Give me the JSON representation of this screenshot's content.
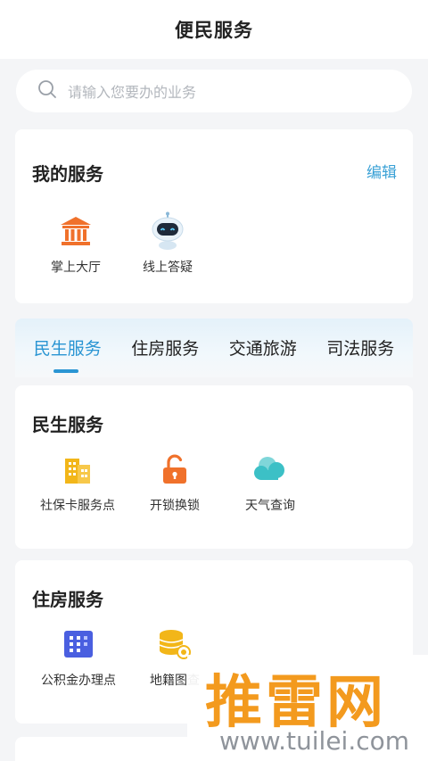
{
  "header": {
    "title": "便民服务"
  },
  "search": {
    "placeholder": "请输入您要办的业务"
  },
  "my_services": {
    "title": "我的服务",
    "edit_label": "编辑",
    "items": [
      {
        "label": "掌上大厅",
        "icon": "government-building-icon"
      },
      {
        "label": "线上答疑",
        "icon": "robot-assistant-icon"
      }
    ]
  },
  "tabs": {
    "active": "民生服务",
    "items": [
      {
        "label": "民生服务"
      },
      {
        "label": "住房服务"
      },
      {
        "label": "交通旅游"
      },
      {
        "label": "司法服务"
      }
    ]
  },
  "livelihood": {
    "title": "民生服务",
    "items": [
      {
        "label": "社保卡服务点",
        "icon": "office-building-icon"
      },
      {
        "label": "开锁换锁",
        "icon": "unlocked-padlock-icon"
      },
      {
        "label": "天气查询",
        "icon": "cloud-icon"
      }
    ]
  },
  "housing": {
    "title": "住房服务",
    "items": [
      {
        "label": "公积金办理点",
        "icon": "apartment-building-icon"
      },
      {
        "label": "地籍图查",
        "icon": "coin-stack-icon"
      }
    ]
  },
  "watermark": {
    "brand": "推雷网",
    "url": "www.tuilei.com"
  },
  "colors": {
    "accent": "#2a95d3",
    "link": "#3aa1d6",
    "orange": "#f0712b",
    "teal": "#3cc0c6",
    "indigo": "#4a5fe0",
    "gold": "#f2b619"
  }
}
